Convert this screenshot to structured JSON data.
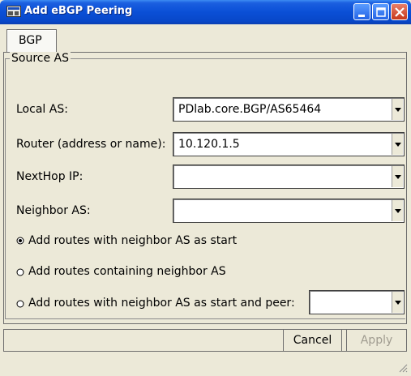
{
  "window": {
    "title": "Add eBGP Peering",
    "icon": "app-window-icon"
  },
  "tabs": [
    {
      "label": "BGP",
      "selected": true
    }
  ],
  "group": {
    "title": "Source AS"
  },
  "fields": {
    "local_as": {
      "label": "Local AS:",
      "value": "PDlab.core.BGP/AS65464"
    },
    "router": {
      "label": "Router (address or name):",
      "value": "10.120.1.5"
    },
    "nexthop": {
      "label": "NextHop IP:",
      "value": ""
    },
    "neighbor": {
      "label": "Neighbor AS:",
      "value": ""
    }
  },
  "options": [
    {
      "label": "Add routes with neighbor AS as start",
      "selected": true
    },
    {
      "label": "Add routes containing neighbor AS",
      "selected": false
    },
    {
      "label": "Add routes with neighbor AS as start and peer:",
      "selected": false
    }
  ],
  "peer_combo": {
    "value": ""
  },
  "buttons": {
    "cancel": "Cancel",
    "apply": "Apply",
    "apply_enabled": false
  }
}
